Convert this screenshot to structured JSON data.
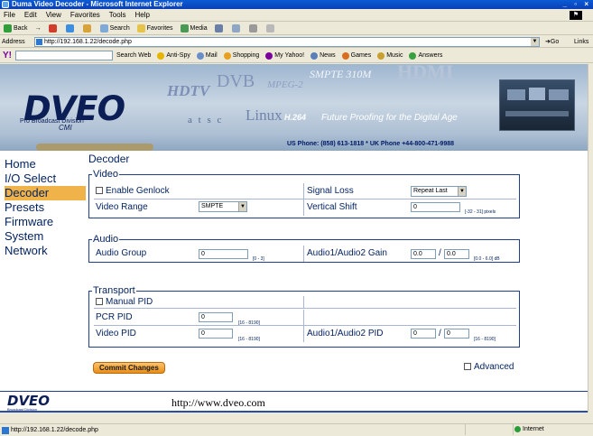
{
  "window": {
    "title": "Duma Video Decoder - Microsoft Internet Explorer",
    "controls": "_ ▫ ×"
  },
  "menu": [
    "File",
    "Edit",
    "View",
    "Favorites",
    "Tools",
    "Help"
  ],
  "toolbar": {
    "back": "Back",
    "forward": "→",
    "search": "Search",
    "favorites": "Favorites",
    "media": "Media"
  },
  "address": {
    "label": "Address",
    "url": "http://192.168.1.22/decode.php",
    "go": "Go",
    "links": "Links"
  },
  "yahoo_toolbar": {
    "logo": "Y!",
    "search_web": "Search Web",
    "items": [
      "Anti-Spy",
      "Mail",
      "Shopping",
      "My Yahoo!",
      "News",
      "Games",
      "Music",
      "Answers"
    ]
  },
  "banner": {
    "logo": "DVEO",
    "division": "Pro Broadcast Division",
    "sublogo": "CMI",
    "words": [
      "HDTV",
      "DVB",
      "MPEG-2",
      "SMPTE 310M",
      "HDMI",
      "a t s c",
      "Linux"
    ],
    "h264": "H.264",
    "tagline": "Future Proofing for the Digital Age",
    "phone": "US Phone: (858) 613-1818  *  UK Phone +44-800-471-9988"
  },
  "nav": [
    "Home",
    "I/O Select",
    "Decoder",
    "Presets",
    "Firmware",
    "System",
    "Network"
  ],
  "page": {
    "title": "Decoder"
  },
  "video": {
    "legend": "Video",
    "enable_genlock": "Enable Genlock",
    "video_range_label": "Video Range",
    "video_range_value": "SMPTE",
    "signal_loss_label": "Signal Loss",
    "signal_loss_value": "Repeat Last",
    "vertical_shift_label": "Vertical Shift",
    "vertical_shift_value": "0",
    "vertical_shift_hint": "[-32 - 31] pixels"
  },
  "audio": {
    "legend": "Audio",
    "group_label": "Audio Group",
    "group_value": "0",
    "group_hint": "[0 - 3]",
    "gain_label": "Audio1/Audio2 Gain",
    "gain1": "0.0",
    "gain2": "0.0",
    "sep": "/",
    "gain_hint": "[0.0 - 6.0] dB"
  },
  "transport": {
    "legend": "Transport",
    "manual_pid": "Manual PID",
    "pcr_label": "PCR PID",
    "pcr_value": "0",
    "pcr_hint": "[16 - 8190]",
    "video_pid_label": "Video PID",
    "video_pid_value": "0",
    "video_pid_hint": "[16 - 8190]",
    "audio_pid_label": "Audio1/Audio2 PID",
    "audio_pid1": "0",
    "audio_pid2": "0",
    "sep": "/",
    "audio_pid_hint": "[16 - 8190]"
  },
  "actions": {
    "commit": "Commit Changes",
    "advanced": "Advanced"
  },
  "footer": {
    "logo": "DVEO",
    "division": "Broadcast Division",
    "url": "http://www.dveo.com"
  },
  "status": {
    "text": "http://192.168.1.22/decode.php",
    "zone": "Internet"
  }
}
